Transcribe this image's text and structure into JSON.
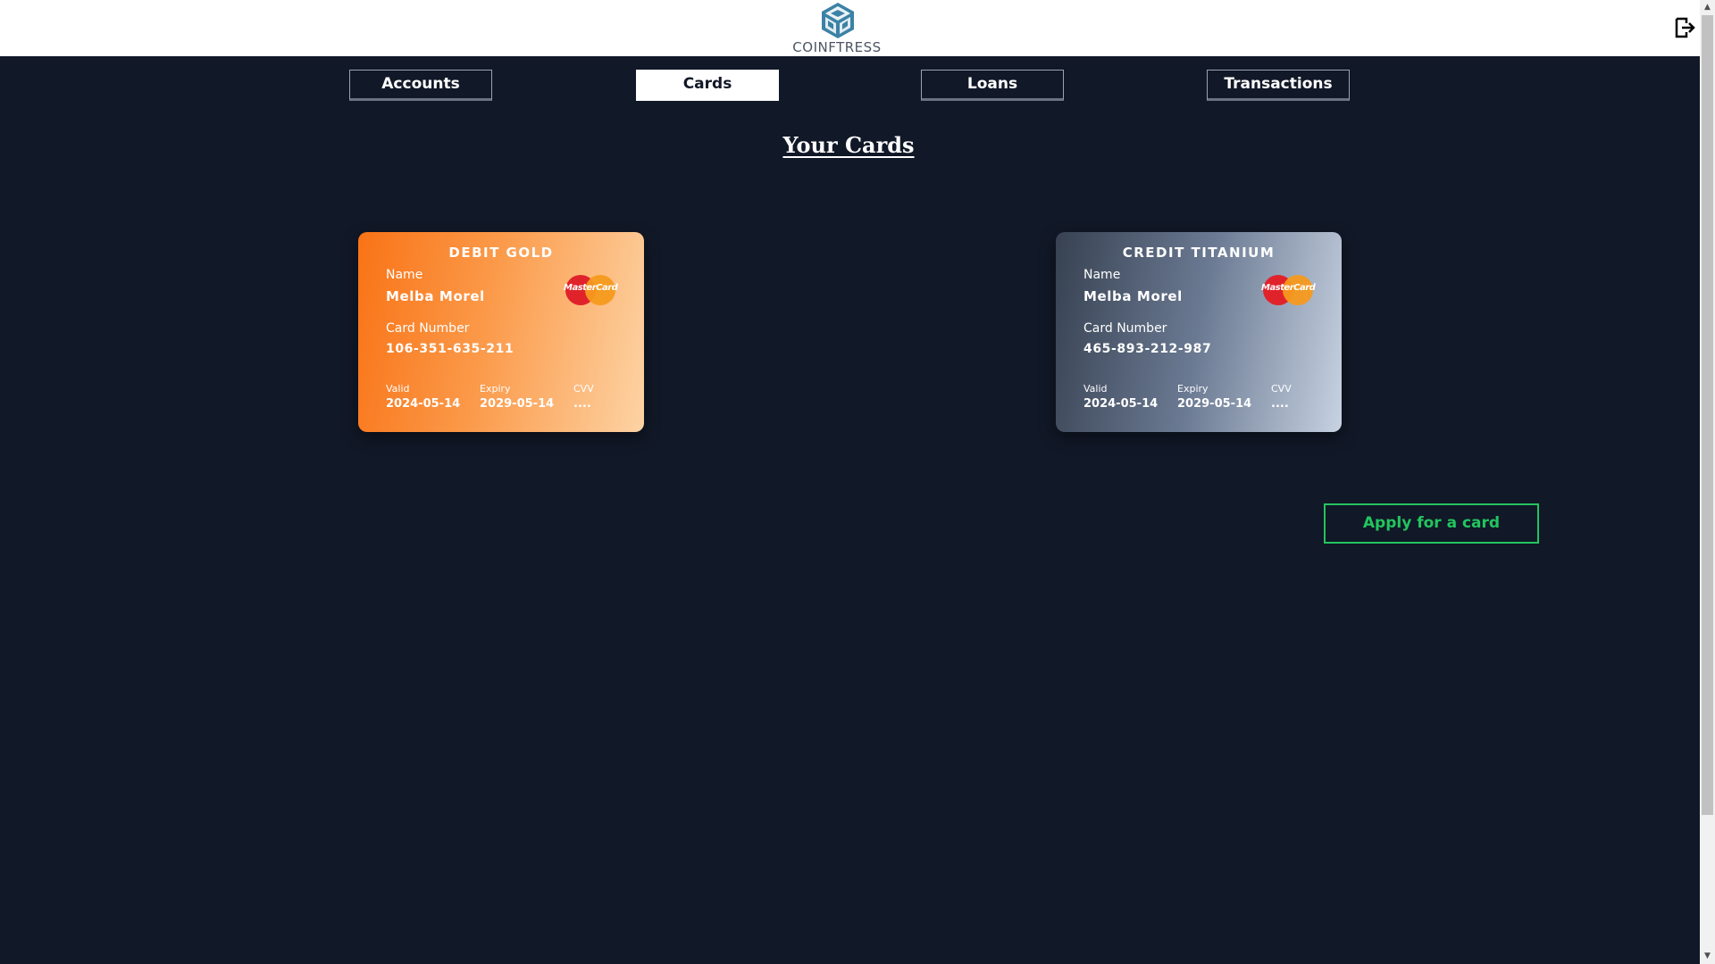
{
  "brand": {
    "name": "COINFTRESS",
    "logo_icon": "fortress-cube-icon",
    "logo_color": "#3b82a6"
  },
  "header": {
    "logout_icon": "logout-icon"
  },
  "nav": {
    "tabs": [
      {
        "label": "Accounts",
        "active": false
      },
      {
        "label": "Cards",
        "active": true
      },
      {
        "label": "Loans",
        "active": false
      },
      {
        "label": "Transactions",
        "active": false
      }
    ]
  },
  "main": {
    "title": "Your Cards",
    "apply_button_label": "Apply for a card"
  },
  "cards": [
    {
      "type": "DEBIT GOLD",
      "name_label": "Name",
      "name": "Melba Morel",
      "number_label": "Card Number",
      "number": "106-351-635-211",
      "valid_label": "Valid",
      "valid": "2024-05-14",
      "expiry_label": "Expiry",
      "expiry": "2029-05-14",
      "cvv_label": "CVV",
      "cvv": "....",
      "network": "MasterCard",
      "gradient_start": "#f97316",
      "gradient_end": "#fdd3a4"
    },
    {
      "type": "CREDIT TITANIUM",
      "name_label": "Name",
      "name": "Melba Morel",
      "number_label": "Card Number",
      "number": "465-893-212-987",
      "valid_label": "Valid",
      "valid": "2024-05-14",
      "expiry_label": "Expiry",
      "expiry": "2029-05-14",
      "cvv_label": "CVV",
      "cvv": "....",
      "network": "MasterCard",
      "gradient_start": "#374151",
      "gradient_end": "#c7d2e1"
    }
  ],
  "colors": {
    "background": "#111827",
    "header_bg": "#ffffff",
    "accent_green": "#22c55e"
  }
}
